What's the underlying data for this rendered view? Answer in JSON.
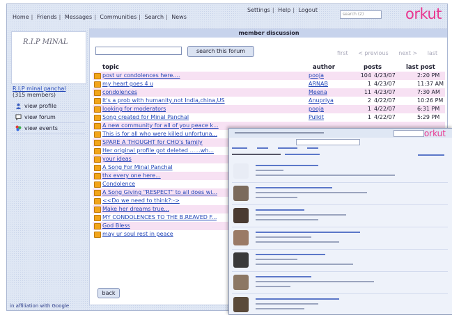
{
  "nav": {
    "links": [
      "Home",
      "Friends",
      "Messages",
      "Communities",
      "Search",
      "News"
    ],
    "center_links": [
      "Settings",
      "Help",
      "Logout"
    ],
    "search_placeholder": "search (2)",
    "logo": "orkut"
  },
  "sidebar": {
    "community_name": "R.I.P MINAL",
    "community_link": "R.I.P minal panchal",
    "member_count": "(315 members)",
    "menu": [
      {
        "label": "view profile",
        "icon": "person-icon"
      },
      {
        "label": "view forum",
        "icon": "forum-icon"
      },
      {
        "label": "view events",
        "icon": "events-icon"
      }
    ],
    "footer": "in affiliation with Google"
  },
  "main": {
    "header": "member discussion",
    "search_button": "search this forum",
    "pager": [
      "first",
      "< previous",
      "next >",
      "last"
    ],
    "columns": {
      "topic": "topic",
      "author": "author",
      "posts": "posts",
      "last_post": "last post"
    },
    "rows": [
      {
        "topic": "post ur condolences here....",
        "author": "pooja",
        "posts": "104",
        "date": "4/23/07",
        "time": "2:20 PM"
      },
      {
        "topic": "my heart goes 4 u",
        "author": "ARNAB",
        "posts": "1",
        "date": "4/23/07",
        "time": "11:37 AM"
      },
      {
        "topic": "condolences",
        "author": "Meena",
        "posts": "11",
        "date": "4/23/07",
        "time": "7:30 AM"
      },
      {
        "topic": "It's a prob with humanity,not India,china,US",
        "author": "Anupriya",
        "posts": "2",
        "date": "4/22/07",
        "time": "10:26 PM"
      },
      {
        "topic": "looking for moderators",
        "author": "pooja",
        "posts": "1",
        "date": "4/22/07",
        "time": "6:31 PM"
      },
      {
        "topic": "Song created for Minal Panchal",
        "author": "Pulkit",
        "posts": "1",
        "date": "4/22/07",
        "time": "5:29 PM"
      },
      {
        "topic": "A new community for all of you peace k...",
        "author": "",
        "posts": "",
        "date": "",
        "time": ""
      },
      {
        "topic": "This is for all who were killed unfortuna...",
        "author": "",
        "posts": "",
        "date": "",
        "time": ""
      },
      {
        "topic": "SPARE A THOUGHT for CHO's family",
        "author": "",
        "posts": "",
        "date": "",
        "time": ""
      },
      {
        "topic": "Her original profile got deleted ......wh...",
        "author": "",
        "posts": "",
        "date": "",
        "time": ""
      },
      {
        "topic": "your ideas",
        "author": "",
        "posts": "",
        "date": "",
        "time": ""
      },
      {
        "topic": "A Song For Minal Panchal",
        "author": "",
        "posts": "",
        "date": "",
        "time": ""
      },
      {
        "topic": "thx every one here...",
        "author": "",
        "posts": "",
        "date": "",
        "time": ""
      },
      {
        "topic": "Condolence",
        "author": "",
        "posts": "",
        "date": "",
        "time": ""
      },
      {
        "topic": "A Song Giving \"RESPECT\" to all does wi...",
        "author": "",
        "posts": "",
        "date": "",
        "time": ""
      },
      {
        "topic": "<<Do we need to think?:->",
        "author": "",
        "posts": "",
        "date": "",
        "time": ""
      },
      {
        "topic": "Make her dreams true...",
        "author": "",
        "posts": "",
        "date": "",
        "time": ""
      },
      {
        "topic": "MY CONDOLENCES TO THE B.REAVED F...",
        "author": "",
        "posts": "",
        "date": "",
        "time": ""
      },
      {
        "topic": "God Bless",
        "author": "",
        "posts": "",
        "date": "",
        "time": ""
      },
      {
        "topic": "may ur soul rest in peace",
        "author": "",
        "posts": "",
        "date": "",
        "time": ""
      }
    ],
    "back_button": "back"
  },
  "overlay": {
    "logo": "orkut"
  }
}
